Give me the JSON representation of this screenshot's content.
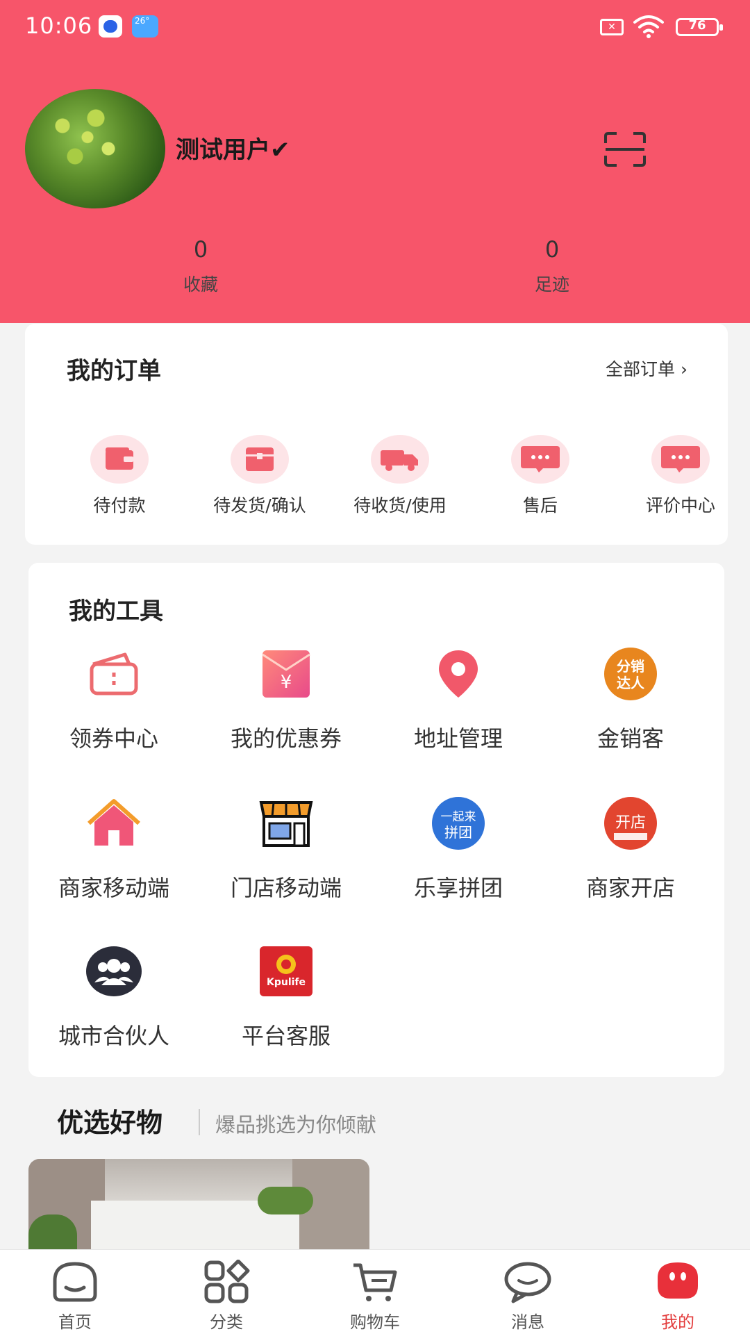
{
  "status_bar": {
    "time": "10:06",
    "weather_badge": "26°",
    "battery": "76"
  },
  "profile": {
    "username": "测试用户✔",
    "stats": [
      {
        "value": "0",
        "label": "收藏"
      },
      {
        "value": "0",
        "label": "足迹"
      }
    ]
  },
  "orders": {
    "title": "我的订单",
    "all_orders": "全部订单 ›",
    "items": [
      {
        "label": "待付款",
        "icon": "wallet-icon"
      },
      {
        "label": "待发货/确认",
        "icon": "box-icon"
      },
      {
        "label": "待收货/使用",
        "icon": "truck-icon"
      },
      {
        "label": "售后",
        "icon": "chat-bubble-icon"
      },
      {
        "label": "评价中心",
        "icon": "chat-bubble-icon"
      }
    ]
  },
  "tools": {
    "title": "我的工具",
    "items": [
      {
        "label": "领券中心",
        "icon": "coupon-wallet-icon"
      },
      {
        "label": "我的优惠券",
        "icon": "red-envelope-icon"
      },
      {
        "label": "地址管理",
        "icon": "location-pin-icon"
      },
      {
        "label": "金销客",
        "icon": "distributor-badge-icon",
        "badge_text": "分销达人"
      },
      {
        "label": "商家移动端",
        "icon": "house-icon"
      },
      {
        "label": "门店移动端",
        "icon": "storefront-icon"
      },
      {
        "label": "乐享拼团",
        "icon": "group-buy-icon",
        "badge_text": "一起来拼团"
      },
      {
        "label": "商家开店",
        "icon": "open-shop-icon",
        "badge_text": "开店"
      },
      {
        "label": "城市合伙人",
        "icon": "partners-icon"
      },
      {
        "label": "平台客服",
        "icon": "kpulife-logo-icon",
        "badge_text": "Kpulife"
      }
    ]
  },
  "recommend": {
    "title": "优选好物",
    "subtitle": "爆品挑选为你倾献"
  },
  "bottom_nav": [
    {
      "label": "首页",
      "icon": "home-icon",
      "active": false
    },
    {
      "label": "分类",
      "icon": "category-icon",
      "active": false
    },
    {
      "label": "购物车",
      "icon": "cart-icon",
      "active": false
    },
    {
      "label": "消息",
      "icon": "message-icon",
      "active": false
    },
    {
      "label": "我的",
      "icon": "profile-icon",
      "active": true
    }
  ],
  "colors": {
    "header_bg": "#f7556a",
    "accent": "#e33b3b",
    "order_icon_bg": "#fde4e7"
  }
}
